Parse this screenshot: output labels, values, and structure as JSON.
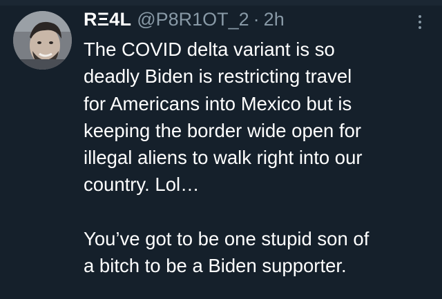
{
  "tweet": {
    "display_name": "RΞ4L",
    "handle": "@P8R1OT_2",
    "separator": "·",
    "time": "2h",
    "avatar_icon": "user-avatar",
    "more_icon": "more-vertical-icon",
    "paragraph1_lines": [
      "The COVID delta variant is so",
      "deadly Biden is restricting travel",
      "for Americans into Mexico but is",
      "keeping the border wide open for",
      "illegal aliens to walk right into our",
      "country. Lol…"
    ],
    "paragraph2_lines": [
      "You’ve got to be one stupid son of",
      "a bitch to be a Biden supporter."
    ]
  },
  "colors": {
    "background": "#15202b",
    "text_primary": "#ffffff",
    "text_secondary": "#8899a6"
  }
}
